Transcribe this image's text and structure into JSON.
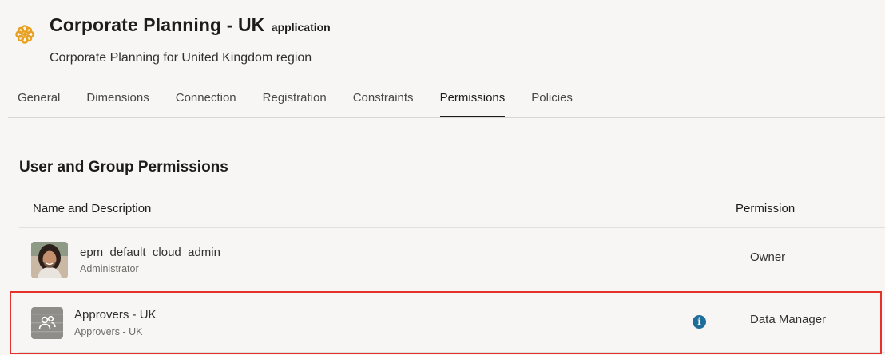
{
  "header": {
    "title": "Corporate Planning - UK",
    "title_suffix": "application",
    "subtitle": "Corporate Planning for United Kingdom region",
    "icon": "flower-icon",
    "icon_color": "#e8a020"
  },
  "tabs": [
    {
      "label": "General",
      "active": false
    },
    {
      "label": "Dimensions",
      "active": false
    },
    {
      "label": "Connection",
      "active": false
    },
    {
      "label": "Registration",
      "active": false
    },
    {
      "label": "Constraints",
      "active": false
    },
    {
      "label": "Permissions",
      "active": true
    },
    {
      "label": "Policies",
      "active": false
    }
  ],
  "section": {
    "title": "User and Group Permissions"
  },
  "table": {
    "columns": {
      "name": "Name and Description",
      "permission": "Permission"
    },
    "rows": [
      {
        "name": "epm_default_cloud_admin",
        "description": "Administrator",
        "permission": "Owner",
        "avatar": "user-photo-avatar"
      },
      {
        "name": "Approvers - UK",
        "description": "Approvers - UK",
        "permission": "Data Manager",
        "avatar": "group-icon",
        "info_icon": "info-icon",
        "highlighted": true
      }
    ]
  },
  "colors": {
    "accent_info": "#1f6d99",
    "highlight_border": "#e2322a"
  }
}
